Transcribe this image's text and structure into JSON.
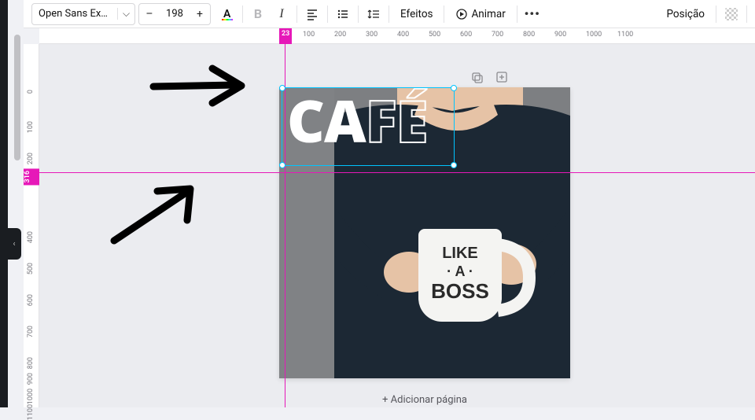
{
  "toolbar": {
    "font_name": "Open Sans Extra ...",
    "font_size": "198",
    "minus": "–",
    "plus": "+",
    "effects_label": "Efeitos",
    "animate_label": "Animar",
    "position_label": "Posição",
    "more": "•••"
  },
  "rulers": {
    "h_ticks": [
      "100",
      "200",
      "300",
      "400",
      "500",
      "600",
      "700",
      "800",
      "900",
      "1000",
      "1100"
    ],
    "h_marker": "23",
    "v_ticks": [
      "0",
      "100",
      "200",
      "400",
      "500",
      "600",
      "700",
      "800",
      "900",
      "1000",
      "1100"
    ],
    "v_marker": "316"
  },
  "canvas": {
    "text_main": "CAFÉ",
    "mug_line1": "LIKE",
    "mug_line2": "· A ·",
    "mug_line3": "BOSS",
    "add_page_prefix": "+ Adicionar página"
  }
}
